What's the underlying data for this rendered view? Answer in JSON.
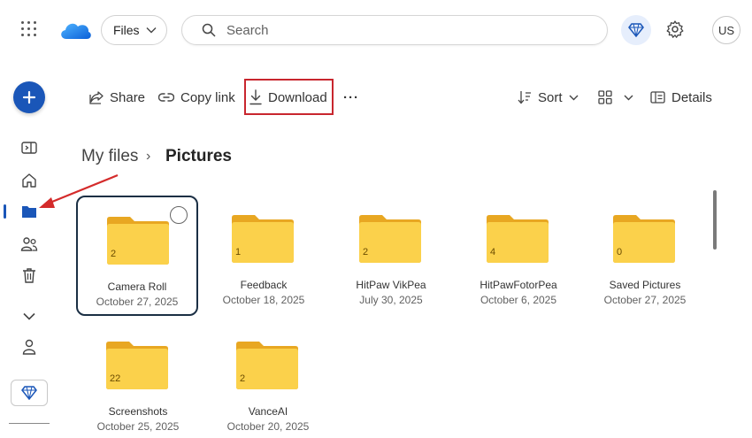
{
  "topbar": {
    "files_label": "Files",
    "search_placeholder": "Search",
    "avatar_initials": "US"
  },
  "toolbar": {
    "share": "Share",
    "copy_link": "Copy link",
    "download": "Download",
    "more": "···",
    "sort": "Sort",
    "details": "Details"
  },
  "breadcrumb": {
    "root": "My files",
    "separator": "›",
    "current": "Pictures"
  },
  "folders": [
    {
      "name": "Camera Roll",
      "date": "October 27, 2025",
      "count": "2",
      "selected": true
    },
    {
      "name": "Feedback",
      "date": "October 18, 2025",
      "count": "1"
    },
    {
      "name": "HitPaw VikPea",
      "date": "July 30, 2025",
      "count": "2"
    },
    {
      "name": "HitPawFotorPea",
      "date": "October 6, 2025",
      "count": "4"
    },
    {
      "name": "Saved Pictures",
      "date": "October 27, 2025",
      "count": "0"
    },
    {
      "name": "Screenshots",
      "date": "October 25, 2025",
      "count": "22"
    },
    {
      "name": "VanceAI",
      "date": "October 20, 2025",
      "count": "2"
    }
  ],
  "colors": {
    "accent": "#1a56b8",
    "highlight": "#c8262e",
    "folder": "#f9c940"
  }
}
